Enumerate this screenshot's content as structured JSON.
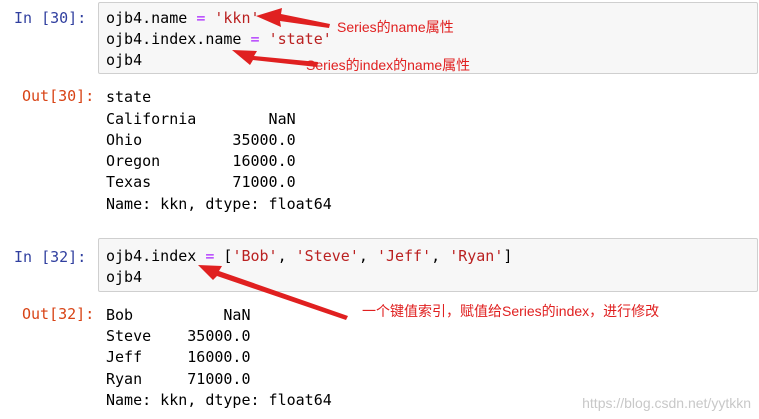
{
  "cells": [
    {
      "in_prompt": "In  [30]:",
      "lines": [
        [
          {
            "t": "ojb4.name "
          },
          {
            "t": "=",
            "c": "op"
          },
          {
            "t": " "
          },
          {
            "t": "'kkn'",
            "c": "str"
          }
        ],
        [
          {
            "t": "ojb4.index.name "
          },
          {
            "t": "=",
            "c": "op"
          },
          {
            "t": " "
          },
          {
            "t": "'state'",
            "c": "str"
          }
        ],
        [
          {
            "t": "ojb4"
          }
        ]
      ],
      "out_prompt": "Out[30]:",
      "output": [
        "state",
        "California        NaN",
        "Ohio          35000.0",
        "Oregon        16000.0",
        "Texas         71000.0",
        "Name: kkn, dtype: float64"
      ]
    },
    {
      "in_prompt": "In  [32]:",
      "lines": [
        [
          {
            "t": "ojb4.index "
          },
          {
            "t": "=",
            "c": "op"
          },
          {
            "t": " ["
          },
          {
            "t": "'Bob'",
            "c": "str"
          },
          {
            "t": ", "
          },
          {
            "t": "'Steve'",
            "c": "str"
          },
          {
            "t": ", "
          },
          {
            "t": "'Jeff'",
            "c": "str"
          },
          {
            "t": ", "
          },
          {
            "t": "'Ryan'",
            "c": "str"
          },
          {
            "t": "]"
          }
        ],
        [
          {
            "t": "ojb4"
          }
        ]
      ],
      "out_prompt": "Out[32]:",
      "output": [
        "Bob          NaN",
        "Steve    35000.0",
        "Jeff     16000.0",
        "Ryan     71000.0",
        "Name: kkn, dtype: float64"
      ]
    }
  ],
  "annotations": {
    "series_name": "Series的name属性",
    "index_name": "Series的index的name属性",
    "index_assign": "一个键值索引，赋值给Series的index，进行修改"
  },
  "colors": {
    "in_prompt": "#303f9f",
    "out_prompt": "#d84315",
    "annotation": "#e02020",
    "string": "#ba2121",
    "operator": "#aa22ff"
  },
  "watermark": "https://blog.csdn.net/yytkkn"
}
